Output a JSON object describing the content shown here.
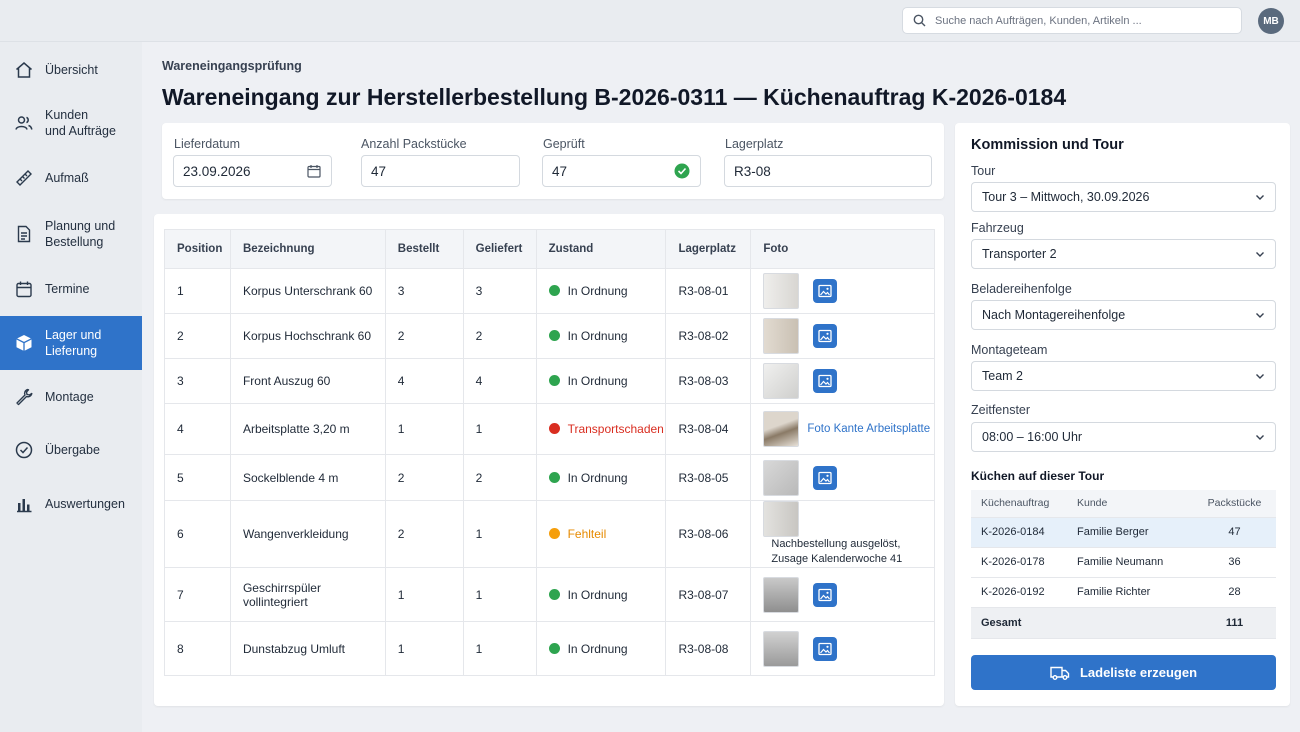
{
  "search": {
    "placeholder": "Suche nach Aufträgen, Kunden, Artikeln ..."
  },
  "user": {
    "initials": "MB"
  },
  "sidebar": {
    "items": [
      {
        "label": "Übersicht",
        "icon": "home-icon"
      },
      {
        "label": "Kunden\nund Aufträge",
        "icon": "users-icon"
      },
      {
        "label": "Aufmaß",
        "icon": "ruler-icon"
      },
      {
        "label": "Planung und\nBestellung",
        "icon": "document-icon"
      },
      {
        "label": "Termine",
        "icon": "calendar-icon"
      },
      {
        "label": "Lager und\nLieferung",
        "icon": "box-icon",
        "active": true
      },
      {
        "label": "Montage",
        "icon": "wrench-icon"
      },
      {
        "label": "Übergabe",
        "icon": "check-circle-icon"
      },
      {
        "label": "Auswertungen",
        "icon": "bar-chart-icon"
      }
    ]
  },
  "page": {
    "subtitle": "Wareneingangsprüfung",
    "title": "Wareneingang zur Herstellerbestellung B-2026-0311 — Küchenauftrag K-2026-0184"
  },
  "fields": {
    "lieferdatum": {
      "label": "Lieferdatum",
      "value": "23.09.2026"
    },
    "packstuecke": {
      "label": "Anzahl Packstücke",
      "value": "47"
    },
    "geprueft": {
      "label": "Geprüft",
      "value": "47"
    },
    "lagerplatz": {
      "label": "Lagerplatz",
      "value": "R3-08"
    }
  },
  "positions": {
    "headers": [
      "Position",
      "Bezeichnung",
      "Bestellt",
      "Geliefert",
      "Zustand",
      "Lagerplatz",
      "Foto"
    ],
    "rows": [
      {
        "pos": "1",
        "name": "Korpus Unterschrank 60",
        "bestellt": "3",
        "geliefert": "3",
        "zustand": "In Ordnung",
        "status": "ok",
        "lager": "R3-08-01",
        "foto": "button"
      },
      {
        "pos": "2",
        "name": "Korpus Hochschrank 60",
        "bestellt": "2",
        "geliefert": "2",
        "zustand": "In Ordnung",
        "status": "ok",
        "lager": "R3-08-02",
        "foto": "button"
      },
      {
        "pos": "3",
        "name": "Front Auszug 60",
        "bestellt": "4",
        "geliefert": "4",
        "zustand": "In Ordnung",
        "status": "ok",
        "lager": "R3-08-03",
        "foto": "button"
      },
      {
        "pos": "4",
        "name": "Arbeitsplatte 3,20 m",
        "bestellt": "1",
        "geliefert": "1",
        "zustand": "Transportschaden",
        "status": "damage",
        "lager": "R3-08-04",
        "foto": "link",
        "foto_text": "Foto Kante Arbeitsplatte"
      },
      {
        "pos": "5",
        "name": "Sockelblende 4 m",
        "bestellt": "2",
        "geliefert": "2",
        "zustand": "In Ordnung",
        "status": "ok",
        "lager": "R3-08-05",
        "foto": "button"
      },
      {
        "pos": "6",
        "name": "Wangenverkleidung",
        "bestellt": "2",
        "geliefert": "1",
        "zustand": "Fehlteil",
        "status": "missing",
        "lager": "R3-08-06",
        "foto": "note",
        "foto_text": "Nachbestellung ausgelöst,\nZusage Kalenderwoche 41"
      },
      {
        "pos": "7",
        "name": "Geschirrspüler vollintegriert",
        "bestellt": "1",
        "geliefert": "1",
        "zustand": "In Ordnung",
        "status": "ok",
        "lager": "R3-08-07",
        "foto": "button"
      },
      {
        "pos": "8",
        "name": "Dunstabzug Umluft",
        "bestellt": "1",
        "geliefert": "1",
        "zustand": "In Ordnung",
        "status": "ok",
        "lager": "R3-08-08",
        "foto": "button"
      }
    ]
  },
  "status_colors": {
    "ok": "#2ea44f",
    "damage": "#d92d20",
    "missing": "#f59e0b"
  },
  "status_text_colors": {
    "ok": "#1f2937",
    "damage": "#d92d20",
    "missing": "#e68a00"
  },
  "tour": {
    "title": "Kommission und Tour",
    "tour_label": "Tour",
    "tour_value": "Tour 3 – Mittwoch, 30.09.2026",
    "fahrzeug_label": "Fahrzeug",
    "fahrzeug_value": "Transporter 2",
    "reihenfolge_label": "Beladereihenfolge",
    "reihenfolge_value": "Nach Montagereihenfolge",
    "team_label": "Montageteam",
    "team_value": "Team 2",
    "zeit_label": "Zeitfenster",
    "zeit_value": "08:00 – 16:00 Uhr",
    "kitchens_title": "Küchen auf dieser Tour",
    "kitchens_headers": [
      "Küchenauftrag",
      "Kunde",
      "Packstücke"
    ],
    "kitchens": [
      {
        "auftrag": "K-2026-0184",
        "kunde": "Familie Berger",
        "pakete": "47"
      },
      {
        "auftrag": "K-2026-0178",
        "kunde": "Familie Neumann",
        "pakete": "36"
      },
      {
        "auftrag": "K-2026-0192",
        "kunde": "Familie Richter",
        "pakete": "28"
      }
    ],
    "sum_label": "Gesamt",
    "sum_value": "111",
    "button_label": "Ladeliste erzeugen"
  },
  "accent_color": "#2f73c9"
}
